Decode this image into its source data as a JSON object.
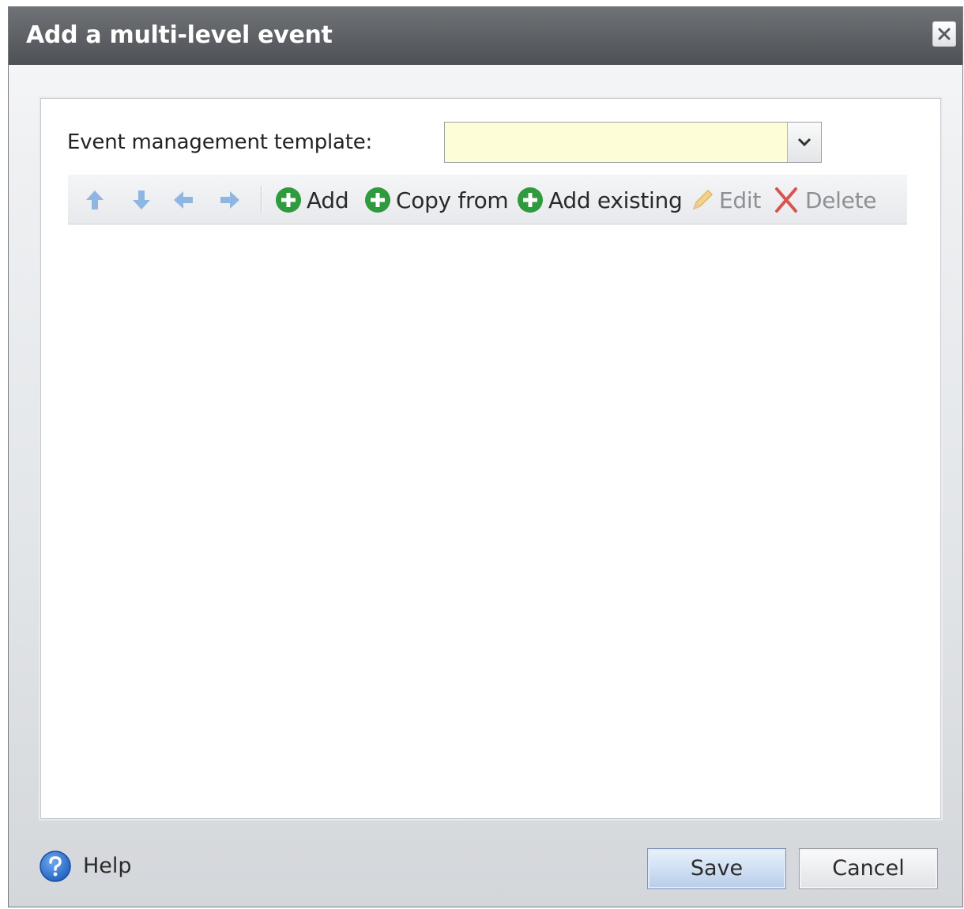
{
  "dialog": {
    "title": "Add a multi-level event",
    "close_icon": "close-icon"
  },
  "form": {
    "template_label": "Event management template:",
    "template_value": "",
    "select_background": "#fdfdd8"
  },
  "toolbar": {
    "move_icons": [
      "arrow-up-icon",
      "arrow-down-icon",
      "arrow-left-icon",
      "arrow-right-icon"
    ],
    "add_label": "Add",
    "copy_from_label": "Copy from",
    "add_existing_label": "Add existing",
    "edit_label": "Edit",
    "delete_label": "Delete"
  },
  "footer": {
    "help_label": "Help",
    "save_label": "Save",
    "cancel_label": "Cancel"
  },
  "colors": {
    "titlebar": "#5a5d61",
    "add_icon_green": "#2f9a3e",
    "delete_red": "#d9534f",
    "disabled_arrow_blue": "#8fb6e2",
    "help_blue": "#2f6fc9"
  }
}
